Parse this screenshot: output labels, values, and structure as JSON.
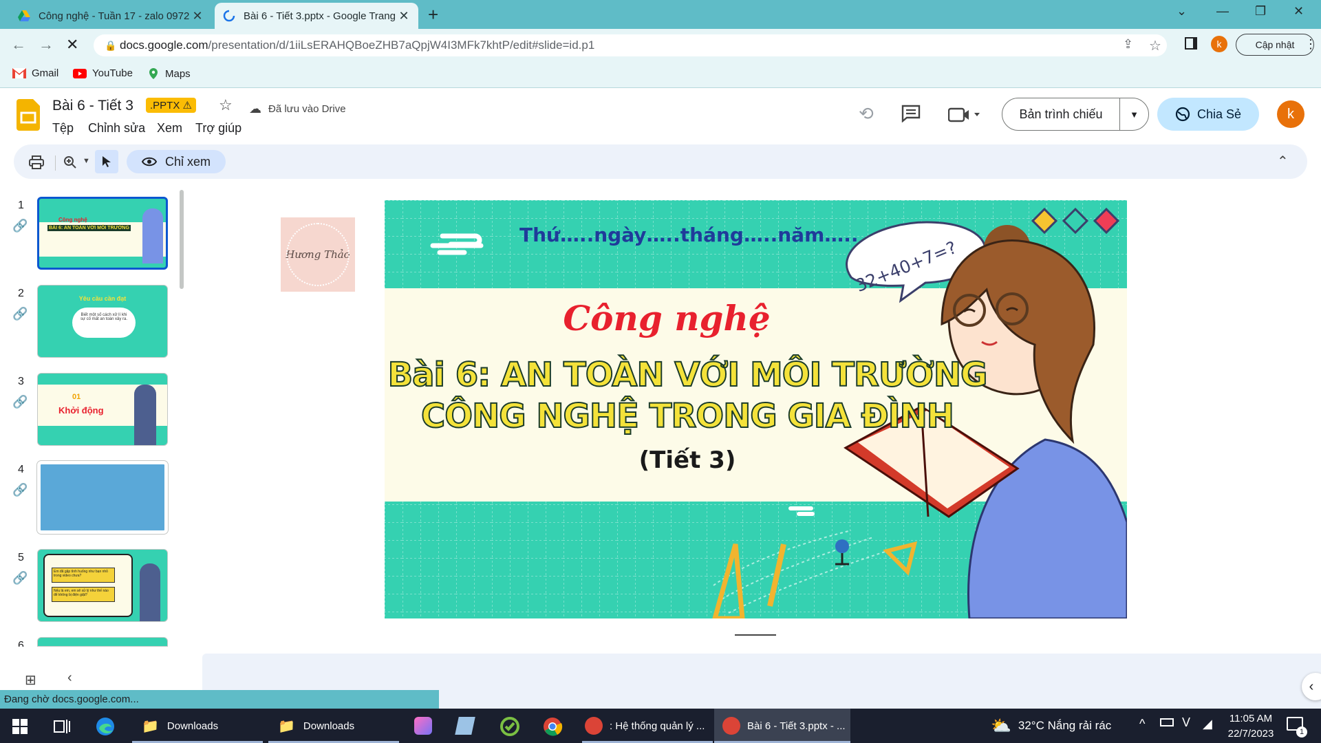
{
  "browser": {
    "tabs": [
      {
        "title": "Công nghệ - Tuần 17 - zalo 0972",
        "active": false
      },
      {
        "title": "Bài 6 - Tiết 3.pptx - Google Trang",
        "active": true
      }
    ],
    "url_domain": "docs.google.com",
    "url_path": "/presentation/d/1iiLsERAHQBoeZHB7aQpjW4I3MFk7khtP/edit#slide=id.p1",
    "update_label": "Cập nhật",
    "profile_initial": "k",
    "bookmarks": [
      "Gmail",
      "YouTube",
      "Maps"
    ]
  },
  "app": {
    "doc_title": "Bài 6 - Tiết 3",
    "format_badge": ".PPTX",
    "saved_status": "Đã lưu vào Drive",
    "menus": [
      "Tệp",
      "Chỉnh sửa",
      "Xem",
      "Trợ giúp"
    ],
    "present_label": "Bản trình chiếu",
    "share_label": "Chia Sẻ",
    "avatar_initial": "k",
    "view_only_label": "Chỉ xem"
  },
  "filmstrip": {
    "numbers": [
      "1",
      "2",
      "3",
      "4",
      "5",
      "6"
    ],
    "thumb2_title": "Yêu cầu cần đạt",
    "thumb2_body": "Biết một số cách xử lí khi sự cố mất an toàn xảy ra.",
    "thumb3_num": "01",
    "thumb3_title": "Khởi động",
    "thumb5_q1": "Em đã gặp tình huống như bạn nhỏ trong video chưa?",
    "thumb5_q2": "Nếu là em, em sẽ xử lý như thế nào để không bị điện giật?"
  },
  "slide": {
    "date_line": "Thứ…..ngày…..tháng…..năm…..",
    "bubble": "32+40+7=?",
    "subject": "Công nghệ",
    "title_line1": "Bài 6: AN TOÀN VỚI MÔI TRƯỜNG",
    "title_line2": "CÔNG NGHỆ TRONG GIA ĐÌNH",
    "period": "(Tiết 3)",
    "stamp": "Hương Thảo",
    "colors": {
      "teal": "#35d1b1",
      "cream": "#fdfbe8",
      "title_fill": "#f4e23a",
      "title_stroke": "#1a3b2a",
      "subject_red": "#e8212e"
    }
  },
  "status_text": "Đang chờ docs.google.com...",
  "taskbar": {
    "items": [
      "Downloads",
      "Downloads",
      ": Hệ thống quản lý ...",
      "Bài 6 - Tiết 3.pptx - ..."
    ],
    "weather": "32°C  Nắng rải rác",
    "time": "11:05 AM",
    "date": "22/7/2023",
    "notif_count": "1"
  }
}
